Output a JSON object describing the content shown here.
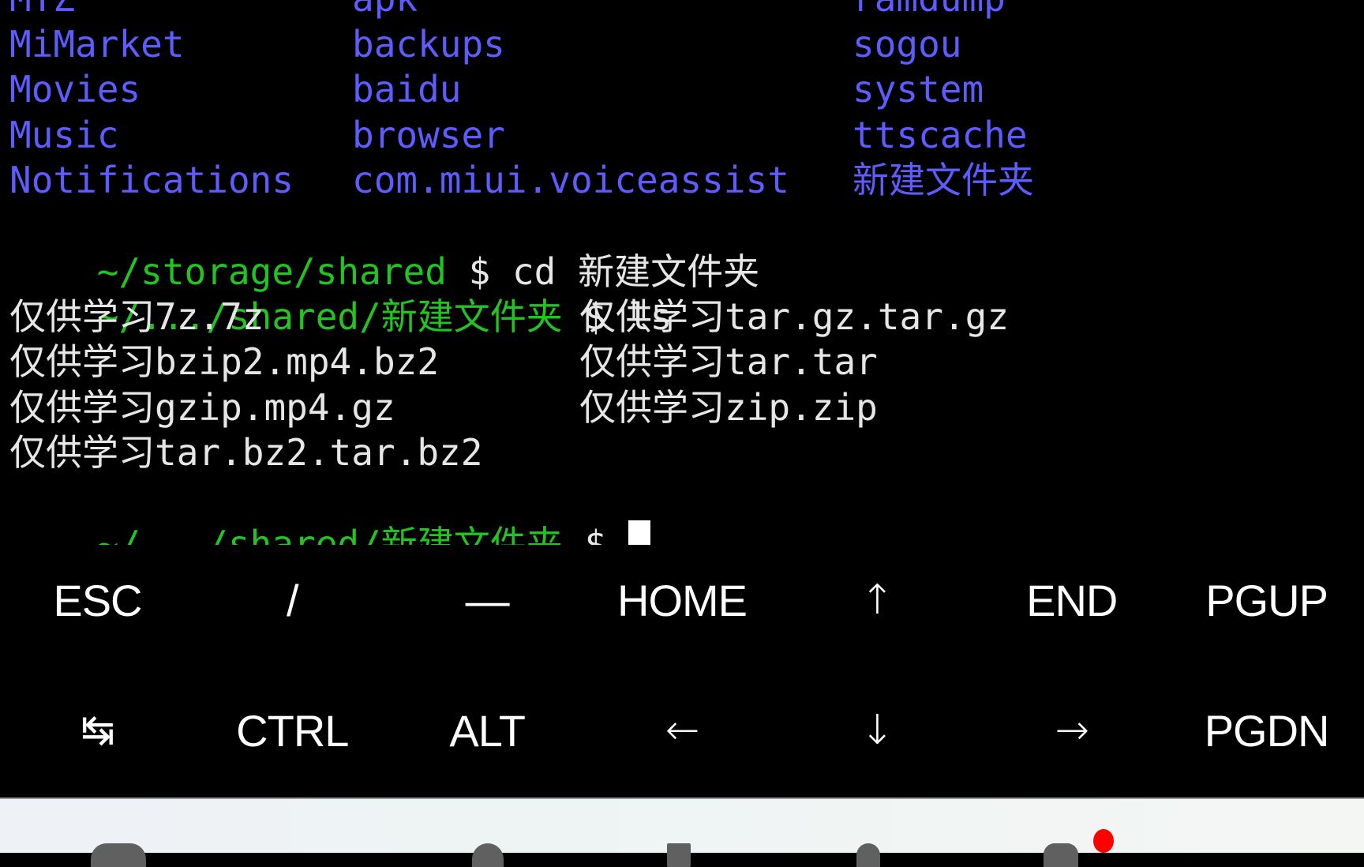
{
  "terminal": {
    "listing_rows": [
      [
        "MTZ",
        "apk",
        "ramdump"
      ],
      [
        "MiMarket",
        "backups",
        "sogou"
      ],
      [
        "Movies",
        "baidu",
        "system"
      ],
      [
        "Music",
        "browser",
        "ttscache"
      ],
      [
        "Notifications",
        "com.miui.voiceassist",
        "新建文件夹"
      ]
    ],
    "cmd1": {
      "path": "~/storage/shared",
      "prompt": " $ ",
      "command": "cd 新建文件夹"
    },
    "cmd2": {
      "path": "~/.../shared/新建文件夹",
      "prompt": " $ ",
      "command": "ls"
    },
    "files": [
      [
        "仅供学习7z.7z",
        "仅供学习tar.gz.tar.gz"
      ],
      [
        "仅供学习bzip2.mp4.bz2",
        "仅供学习tar.tar"
      ],
      [
        "仅供学习gzip.mp4.gz",
        "仅供学习zip.zip"
      ],
      [
        "仅供学习tar.bz2.tar.bz2",
        ""
      ]
    ],
    "current_prompt": {
      "path": "~/.../shared/新建文件夹",
      "prompt": " $ "
    },
    "colors": {
      "directory": "#5c5cff",
      "path": "#22c422",
      "text": "#e6e6e6",
      "background": "#000000"
    }
  },
  "extra_keys": {
    "row1": [
      "ESC",
      "/",
      "—",
      "HOME",
      "↑",
      "END",
      "PGUP"
    ],
    "row2": [
      "↹",
      "CTRL",
      "ALT",
      "←",
      "↓",
      "→",
      "PGDN"
    ]
  },
  "nav_bar": {
    "notification_dot_color": "#ff0000"
  }
}
